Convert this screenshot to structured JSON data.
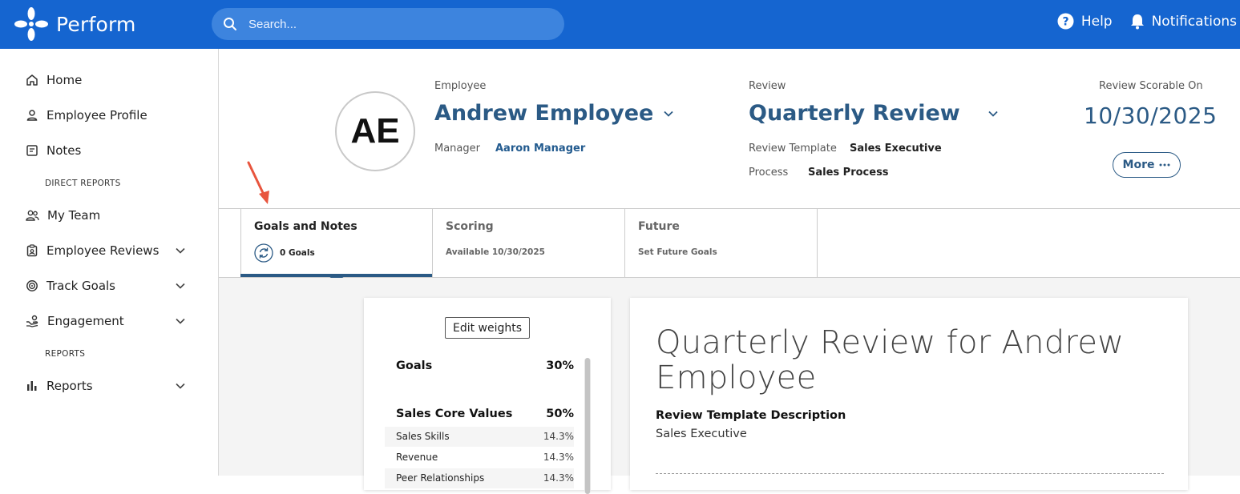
{
  "topbar": {
    "app_name": "Perform",
    "search_placeholder": "Search...",
    "help_label": "Help",
    "notifications_label": "Notifications"
  },
  "sidebar": {
    "items": [
      {
        "label": "Home",
        "icon": "home-icon"
      },
      {
        "label": "Employee Profile",
        "icon": "person-icon"
      },
      {
        "label": "Notes",
        "icon": "notes-icon"
      },
      {
        "label": "My Team",
        "icon": "team-icon"
      },
      {
        "label": "Employee Reviews",
        "icon": "clipboard-icon"
      },
      {
        "label": "Track Goals",
        "icon": "target-icon"
      },
      {
        "label": "Engagement",
        "icon": "engagement-icon"
      },
      {
        "label": "Reports",
        "icon": "bar-chart-icon"
      }
    ],
    "sections": {
      "direct_reports": "DIRECT REPORTS",
      "reports": "REPORTS"
    }
  },
  "header": {
    "avatar_initials": "AE",
    "employee_label": "Employee",
    "employee_name": "Andrew Employee",
    "manager_label": "Manager",
    "manager_name": "Aaron Manager",
    "review_label": "Review",
    "review_name": "Quarterly Review",
    "template_label": "Review Template",
    "template_value": "Sales Executive",
    "process_label": "Process",
    "process_value": "Sales Process",
    "scorable_label": "Review Scorable On",
    "scorable_date": "10/30/2025",
    "more_label": "More"
  },
  "tabs": [
    {
      "title": "Goals and Notes",
      "sub": "0 Goals",
      "active": true
    },
    {
      "title": "Scoring",
      "sub": "Available 10/30/2025",
      "active": false
    },
    {
      "title": "Future",
      "sub": "Set Future Goals",
      "active": false
    }
  ],
  "weights": {
    "edit_label": "Edit weights",
    "groups": [
      {
        "name": "Goals",
        "pct": "30%"
      },
      {
        "name": "Sales Core Values",
        "pct": "50%"
      }
    ],
    "rows": [
      {
        "name": "Sales Skills",
        "pct": "14.3%"
      },
      {
        "name": "Revenue",
        "pct": "14.3%"
      },
      {
        "name": "Peer Relationships",
        "pct": "14.3%"
      }
    ]
  },
  "review_card": {
    "title": "Quarterly Review for Andrew Employee",
    "desc_label": "Review Template Description",
    "desc_value": "Sales Executive"
  },
  "colors": {
    "topbar": "#1565d0",
    "accent": "#2b5a85",
    "annotation_arrow": "#e8553e"
  }
}
